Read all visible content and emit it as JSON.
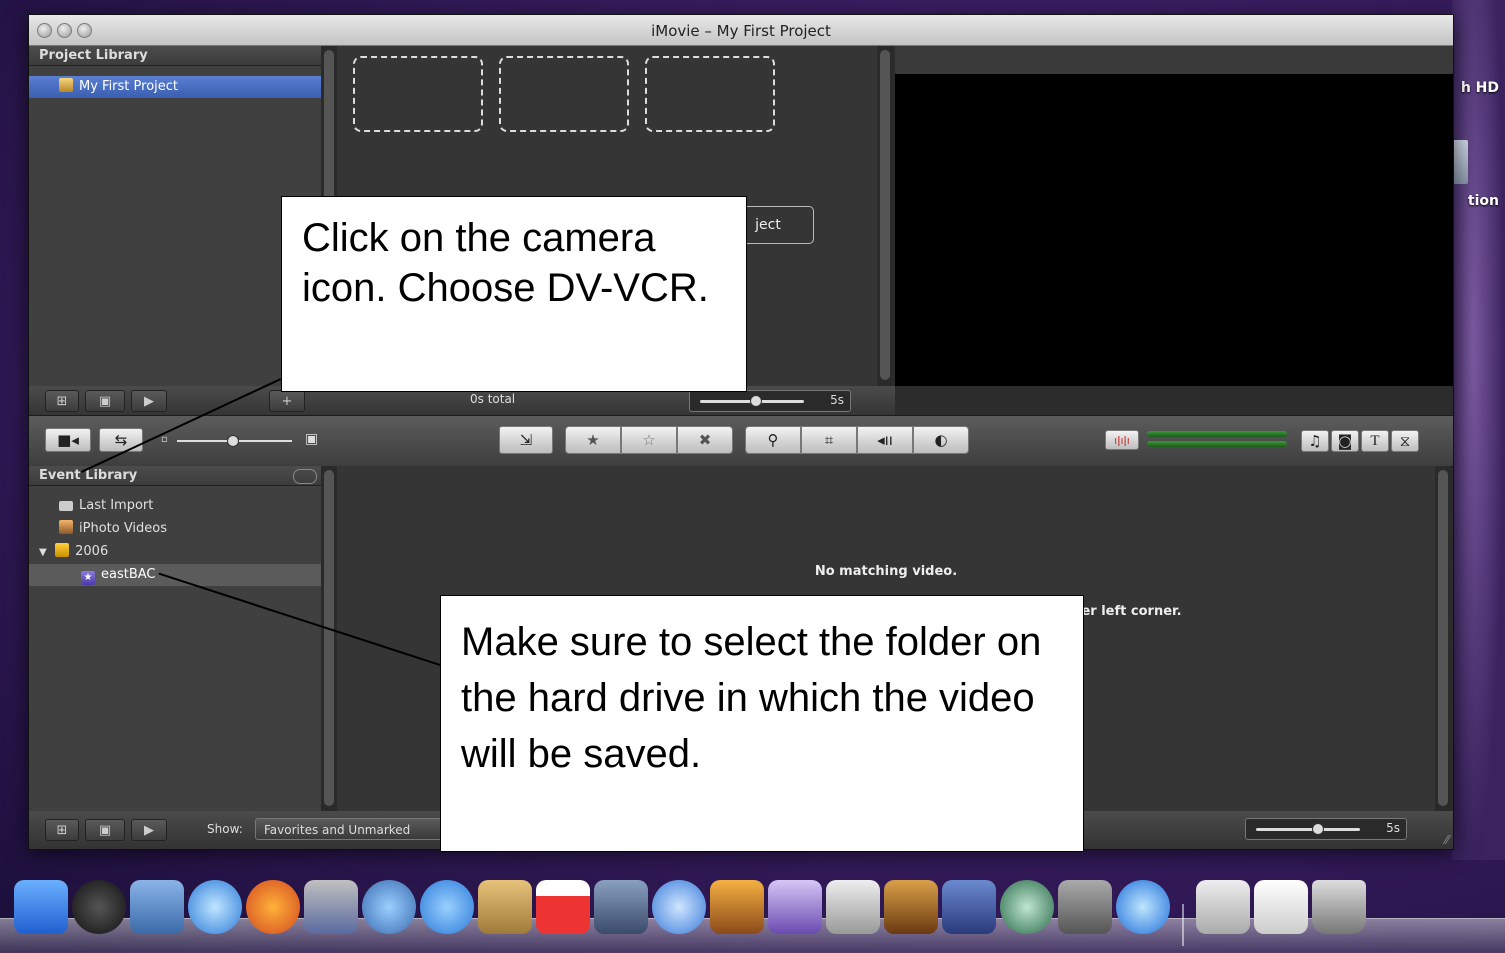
{
  "window": {
    "title": "iMovie – My First Project"
  },
  "desktop": {
    "hd_label": "h HD",
    "app_label": "tion"
  },
  "project_library": {
    "header": "Project Library",
    "items": [
      {
        "label": "My First Project"
      }
    ],
    "partial_button": "ject",
    "total_label": "0s total",
    "duration_label": "5s"
  },
  "event_library": {
    "header": "Event Library",
    "items": [
      {
        "label": "Last Import"
      },
      {
        "label": "iPhoto Videos"
      },
      {
        "label": "2006"
      },
      {
        "label": "eastBAC"
      }
    ]
  },
  "event_viewer": {
    "empty_message": "No matching video.",
    "hint_partial": "ver left corner."
  },
  "bottom_bar": {
    "show_label": "Show:",
    "show_value": "Favorites and Unmarked",
    "duration_label": "5s"
  },
  "toolbar": {
    "icons": [
      "camera-icon",
      "swap-icon",
      "thumbnail-small-icon",
      "thumbnail-large-icon",
      "add-to-project-icon",
      "favorite-icon",
      "unmark-icon",
      "reject-icon",
      "voiceover-icon",
      "crop-icon",
      "audio-adjust-icon",
      "video-adjust-icon",
      "waveform-icon",
      "music-icon",
      "photo-icon",
      "title-icon",
      "transition-icon"
    ]
  },
  "callouts": {
    "camera": "Click on the camera icon. Choose DV-VCR.",
    "folder": "Make sure to select the folder on the hard drive in which the video will be saved."
  },
  "colors": {
    "selection_blue": "#3a5fb0",
    "window_bg": "#2c2c2c",
    "desktop": "#3b1e63"
  }
}
